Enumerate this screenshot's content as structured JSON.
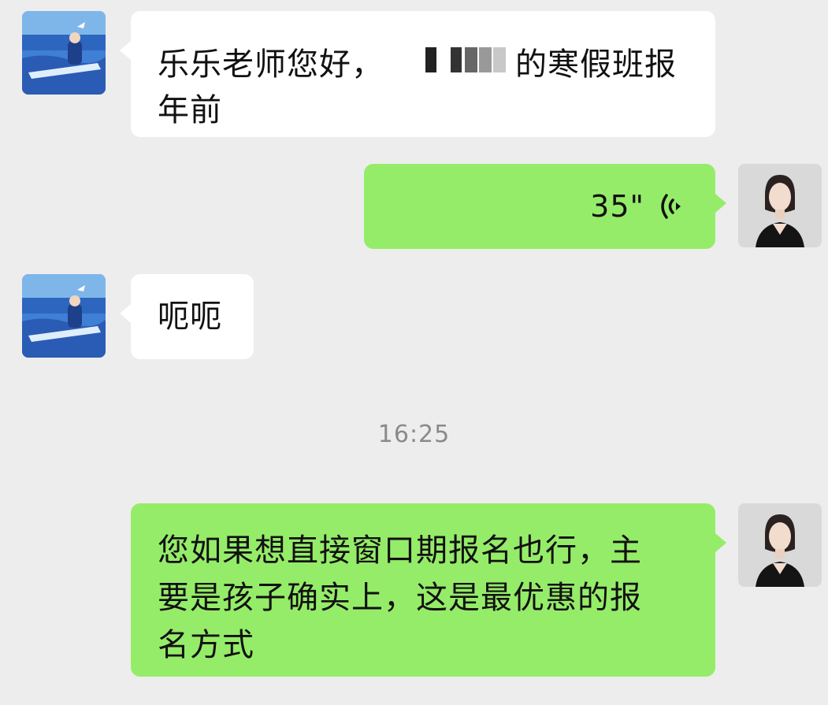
{
  "messages": [
    {
      "direction": "incoming",
      "lines": [
        "乐乐老师您好，",
        "的寒假班报",
        "年前"
      ],
      "redacted": true
    },
    {
      "direction": "outgoing",
      "type": "voice",
      "duration": "35\"",
      "icon": "voice-wave-icon"
    },
    {
      "direction": "incoming",
      "lines": [
        "呃呃"
      ]
    },
    {
      "direction": "outgoing",
      "lines": [
        "您如果想直接窗口期报名也行，主",
        "要是孩子确实上，这是最优惠的报",
        "名方式"
      ]
    }
  ],
  "timestamp": "16:25",
  "colors": {
    "background": "#ededed",
    "incoming_bubble": "#ffffff",
    "outgoing_bubble": "#95ec69"
  }
}
